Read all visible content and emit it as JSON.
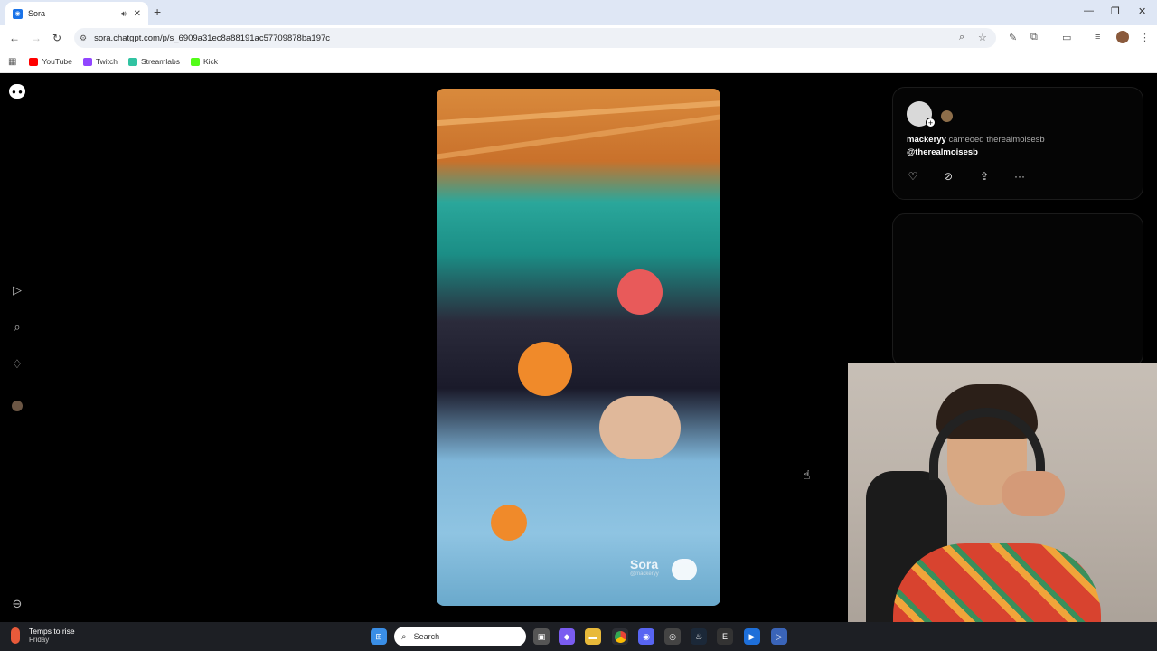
{
  "browser": {
    "tab_title": "Sora",
    "url": "sora.chatgpt.com/p/s_6909a31ec8a88191ac57709878ba197c",
    "bookmarks": [
      {
        "label": "YouTube",
        "color": "#ff0000"
      },
      {
        "label": "Twitch",
        "color": "#9146ff"
      },
      {
        "label": "Streamlabs",
        "color": "#31c3a2"
      },
      {
        "label": "Kick",
        "color": "#53fc18"
      }
    ]
  },
  "post": {
    "author": "mackeryy",
    "action_text": "cameoed",
    "cameo_user": "therealmoisesb",
    "mention": "@therealmoisesb"
  },
  "video": {
    "watermark": "Sora",
    "watermark_handle": "@mackeryy"
  },
  "taskbar": {
    "weather_title": "Temps to rise",
    "weather_sub": "Friday",
    "search_placeholder": "Search"
  }
}
